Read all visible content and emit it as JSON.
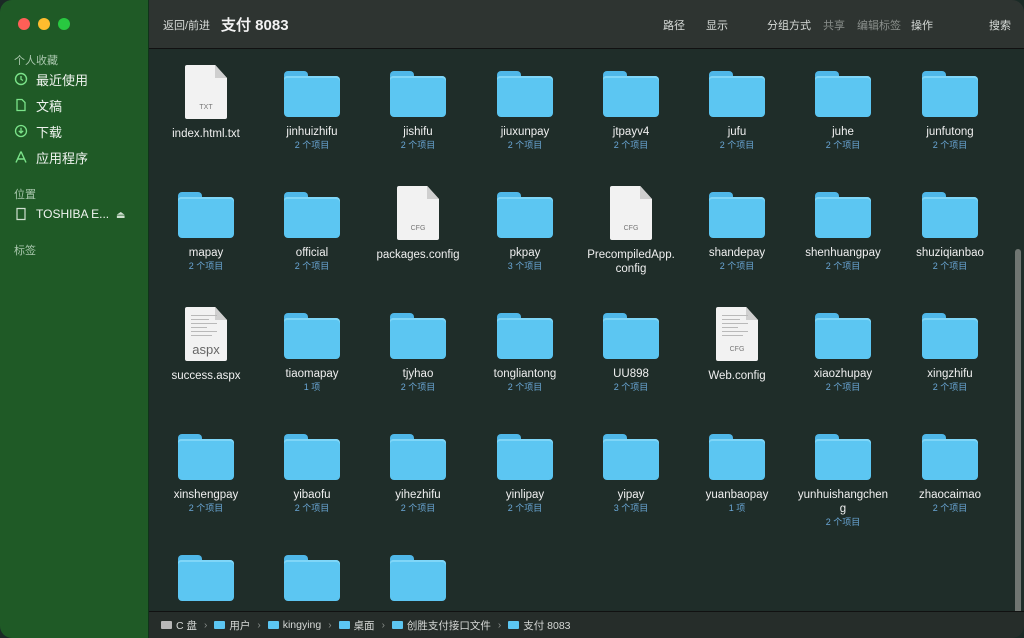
{
  "window": {
    "title": "支付 8083"
  },
  "sidebar": {
    "favorites_title": "个人收藏",
    "favorites": [
      {
        "label": "最近使用",
        "icon": "clock-icon"
      },
      {
        "label": "文稿",
        "icon": "document-icon"
      },
      {
        "label": "下载",
        "icon": "download-icon"
      },
      {
        "label": "应用程序",
        "icon": "apps-icon"
      }
    ],
    "locations_title": "位置",
    "locations": [
      {
        "label": "TOSHIBA E...",
        "icon": "drive-icon"
      }
    ],
    "eject": "⏏",
    "tags_title": "标签"
  },
  "toolbar": {
    "nav": "返回/前进",
    "title": "支付 8083",
    "path": "路径",
    "show": "显示",
    "group": "分组方式",
    "share": "共享",
    "edit_tags": "编辑标签",
    "actions": "操作",
    "search": "搜索"
  },
  "items": [
    {
      "name": "index.html.txt",
      "count": "",
      "kind": "doc",
      "label": "TXT"
    },
    {
      "name": "jinhuizhifu",
      "count": "2 个项目",
      "kind": "folder"
    },
    {
      "name": "jishifu",
      "count": "2 个项目",
      "kind": "folder"
    },
    {
      "name": "jiuxunpay",
      "count": "2 个项目",
      "kind": "folder"
    },
    {
      "name": "jtpayv4",
      "count": "2 个项目",
      "kind": "folder"
    },
    {
      "name": "jufu",
      "count": "2 个项目",
      "kind": "folder"
    },
    {
      "name": "juhe",
      "count": "2 个项目",
      "kind": "folder"
    },
    {
      "name": "junfutong",
      "count": "2 个项目",
      "kind": "folder"
    },
    {
      "name": "mapay",
      "count": "2 个项目",
      "kind": "folder"
    },
    {
      "name": "official",
      "count": "2 个项目",
      "kind": "folder"
    },
    {
      "name": "packages.config",
      "count": "",
      "kind": "doc",
      "label": "CFG"
    },
    {
      "name": "pkpay",
      "count": "3 个项目",
      "kind": "folder"
    },
    {
      "name": "PrecompiledApp.\nconfig",
      "count": "",
      "kind": "doc",
      "label": "CFG"
    },
    {
      "name": "shandepay",
      "count": "2 个项目",
      "kind": "folder"
    },
    {
      "name": "shenhuangpay",
      "count": "2 个项目",
      "kind": "folder"
    },
    {
      "name": "shuziqianbao",
      "count": "2 个项目",
      "kind": "folder"
    },
    {
      "name": "success.aspx",
      "count": "",
      "kind": "aspx",
      "label": "aspx"
    },
    {
      "name": "tiaomapay",
      "count": "1 项",
      "kind": "folder"
    },
    {
      "name": "tjyhao",
      "count": "2 个项目",
      "kind": "folder"
    },
    {
      "name": "tongliantong",
      "count": "2 个项目",
      "kind": "folder"
    },
    {
      "name": "UU898",
      "count": "2 个项目",
      "kind": "folder"
    },
    {
      "name": "Web.config",
      "count": "",
      "kind": "webcfg",
      "label": "CFG"
    },
    {
      "name": "xiaozhupay",
      "count": "2 个项目",
      "kind": "folder"
    },
    {
      "name": "xingzhifu",
      "count": "2 个项目",
      "kind": "folder"
    },
    {
      "name": "xinshengpay",
      "count": "2 个项目",
      "kind": "folder"
    },
    {
      "name": "yibaofu",
      "count": "2 个项目",
      "kind": "folder"
    },
    {
      "name": "yihezhifu",
      "count": "2 个项目",
      "kind": "folder"
    },
    {
      "name": "yinlipay",
      "count": "2 个项目",
      "kind": "folder"
    },
    {
      "name": "yipay",
      "count": "3 个项目",
      "kind": "folder"
    },
    {
      "name": "yuanbaopay",
      "count": "1 项",
      "kind": "folder"
    },
    {
      "name": "yunhuishangchen\ng",
      "count": "2 个项目",
      "kind": "folder"
    },
    {
      "name": "zhaocaimao",
      "count": "2 个项目",
      "kind": "folder"
    },
    {
      "name": "",
      "count": "",
      "kind": "folder"
    },
    {
      "name": "",
      "count": "",
      "kind": "folder"
    },
    {
      "name": "",
      "count": "",
      "kind": "folder"
    }
  ],
  "pathbar": [
    {
      "label": "C 盘",
      "icon": "disk-icon"
    },
    {
      "label": "用户",
      "icon": "folder-icon"
    },
    {
      "label": "kingying",
      "icon": "folder-icon"
    },
    {
      "label": "桌面",
      "icon": "folder-icon"
    },
    {
      "label": "创胜支付接口文件",
      "icon": "folder-icon"
    },
    {
      "label": "支付 8083",
      "icon": "folder-icon"
    }
  ],
  "path_separator": "›"
}
